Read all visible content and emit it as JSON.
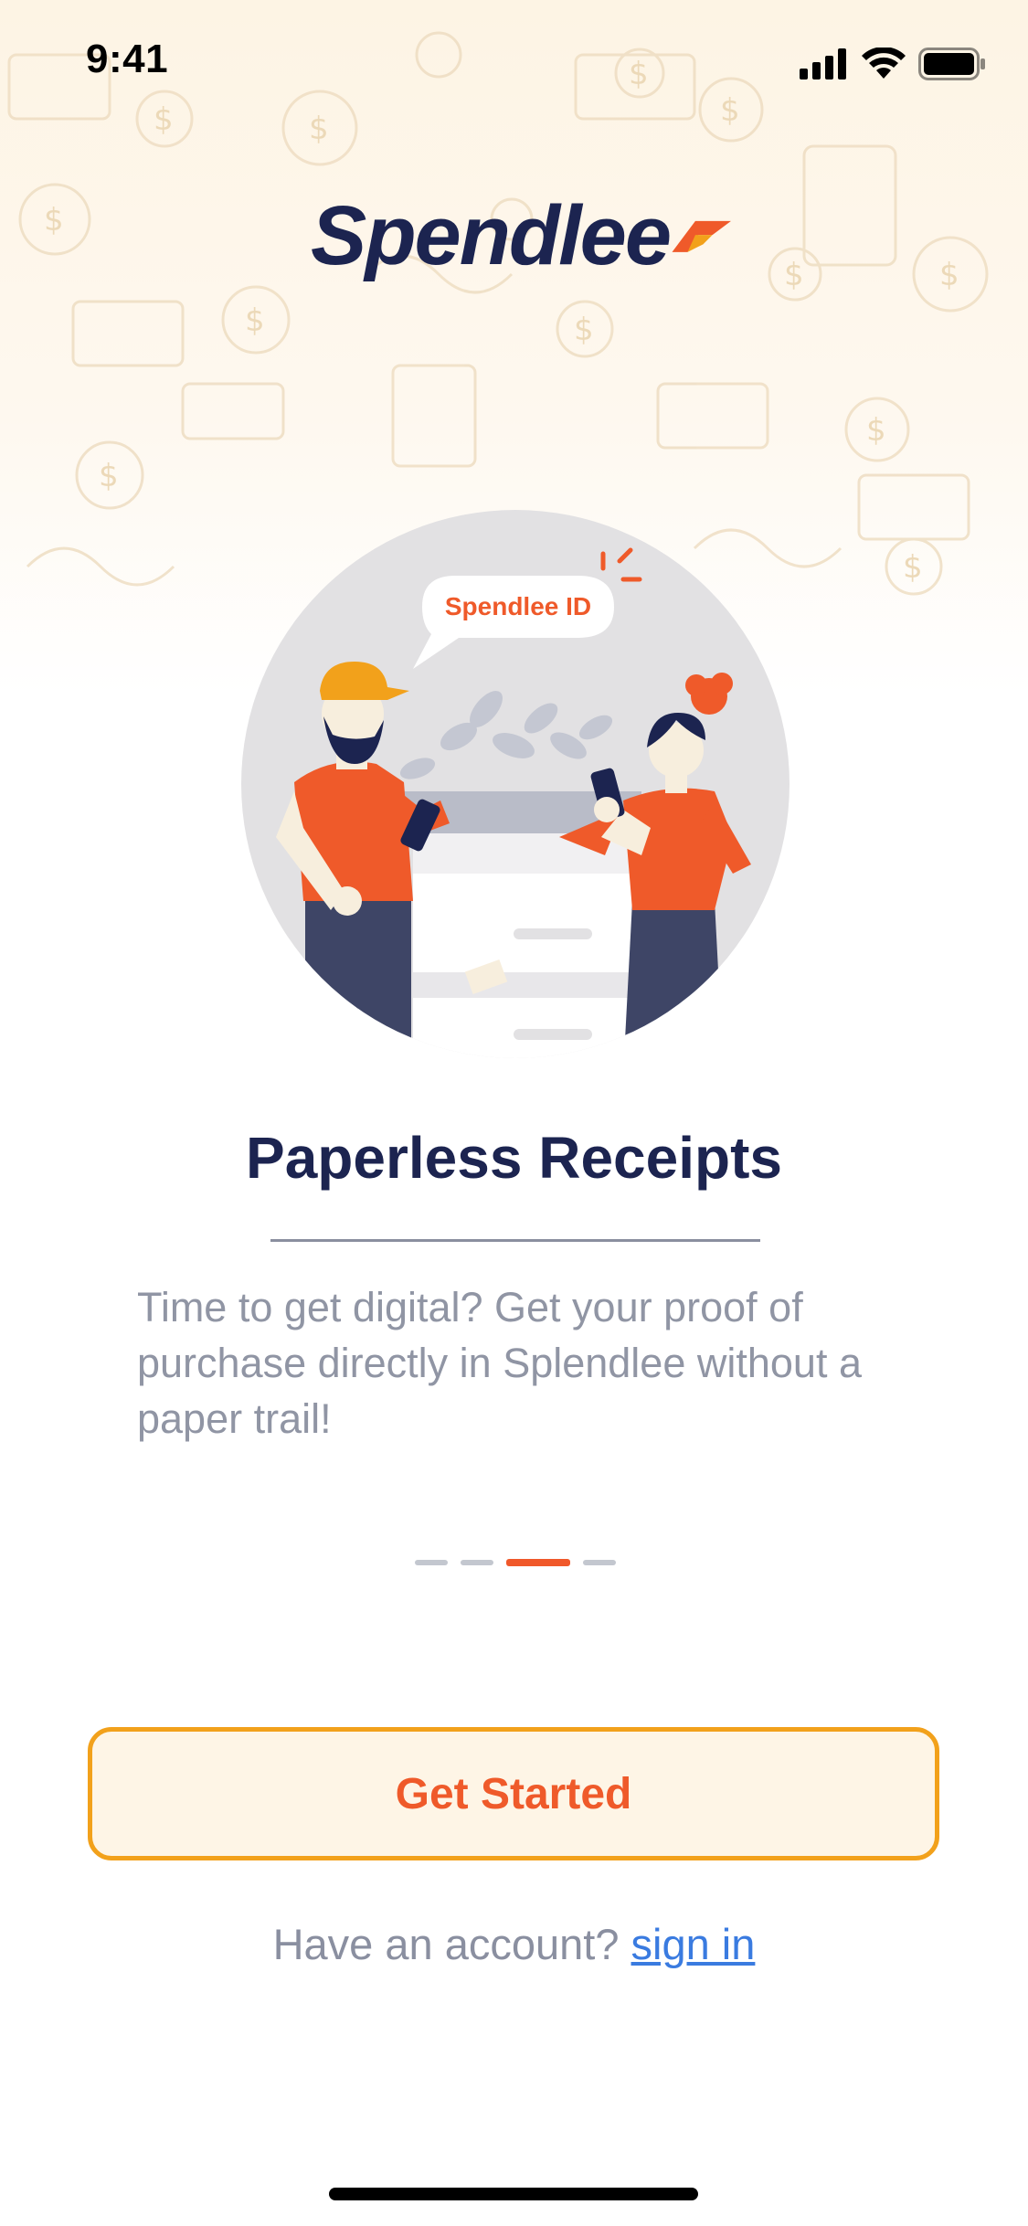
{
  "status_bar": {
    "time": "9:41"
  },
  "brand": {
    "name": "Spendlee"
  },
  "illustration": {
    "speech_bubble": "Spendlee ID"
  },
  "onboarding": {
    "title": "Paperless Receipts",
    "description": "Time to get digital? Get your proof of purchase directly in Splendlee without a paper trail!",
    "pages_total": 4,
    "current_page": 3
  },
  "actions": {
    "primary_label": "Get Started",
    "account_prompt": "Have an account?",
    "signin_label": "sign in"
  },
  "colors": {
    "navy": "#1c2450",
    "accent_orange": "#ef5a2a",
    "button_border": "#f2a11b",
    "link_blue": "#3a7be0"
  }
}
